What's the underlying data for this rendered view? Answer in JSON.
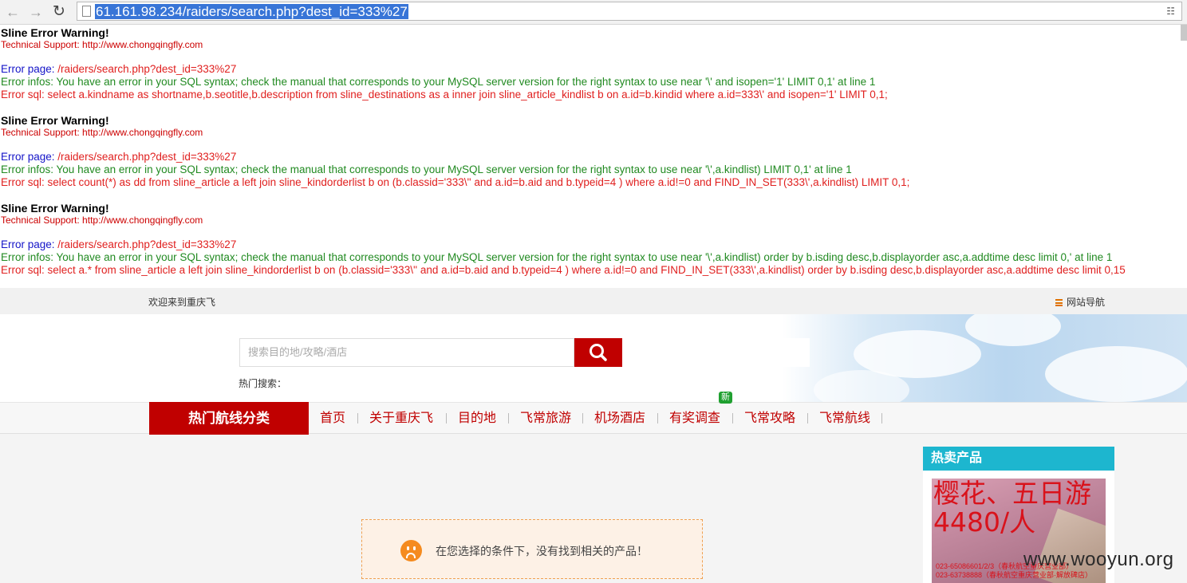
{
  "browser": {
    "url": "61.161.98.234/raiders/search.php?dest_id=333%27",
    "back_icon": "arrow-left-icon",
    "forward_icon": "arrow-right-icon",
    "reload_icon": "reload-icon"
  },
  "errors": [
    {
      "title": "Sline Error Warning!",
      "support": "Technical Support: http://www.chongqingfly.com",
      "page_label": "Error page:",
      "page_value": " /raiders/search.php?dest_id=333%27",
      "infos_label": "Error infos:",
      "infos_value": " You have an error in your SQL syntax; check the manual that corresponds to your MySQL server version for the right syntax to use near '\\' and isopen='1' LIMIT 0,1' at line 1",
      "sql_label": "Error sql:",
      "sql_value": " select a.kindname as shortname,b.seotitle,b.description from sline_destinations as a inner join sline_article_kindlist b on a.id=b.kindid where a.id=333\\' and isopen='1' LIMIT 0,1;"
    },
    {
      "title": "Sline Error Warning!",
      "support": "Technical Support: http://www.chongqingfly.com",
      "page_label": "Error page:",
      "page_value": " /raiders/search.php?dest_id=333%27",
      "infos_label": "Error infos:",
      "infos_value": " You have an error in your SQL syntax; check the manual that corresponds to your MySQL server version for the right syntax to use near '\\',a.kindlist) LIMIT 0,1' at line 1",
      "sql_label": "Error sql:",
      "sql_value": " select count(*) as dd from sline_article a left join sline_kindorderlist b on (b.classid='333\\'' and a.id=b.aid and b.typeid=4 ) where a.id!=0 and FIND_IN_SET(333\\',a.kindlist) LIMIT 0,1;"
    },
    {
      "title": "Sline Error Warning!",
      "support": "Technical Support: http://www.chongqingfly.com",
      "page_label": "Error page:",
      "page_value": " /raiders/search.php?dest_id=333%27",
      "infos_label": "Error infos:",
      "infos_value": " You have an error in your SQL syntax; check the manual that corresponds to your MySQL server version for the right syntax to use near '\\',a.kindlist) order by b.isding desc,b.displayorder asc,a.addtime desc limit 0,' at line 1",
      "sql_label": "Error sql:",
      "sql_value": " select a.* from sline_article a left join sline_kindorderlist b on (b.classid='333\\'' and a.id=b.aid and b.typeid=4 ) where a.id!=0 and FIND_IN_SET(333\\',a.kindlist) order by b.isding desc,b.displayorder asc,a.addtime desc limit 0,15"
    }
  ],
  "topbar": {
    "welcome": "欢迎来到重庆飞",
    "site_nav": "网站导航"
  },
  "search": {
    "placeholder": "搜索目的地/攻略/酒店",
    "hot_label": "热门搜索："
  },
  "menu": {
    "category_button": "热门航线分类",
    "items": [
      "首页",
      "关于重庆飞",
      "目的地",
      "飞常旅游",
      "机场酒店",
      "有奖调查",
      "飞常攻略",
      "飞常航线"
    ],
    "new_badge": "新"
  },
  "content": {
    "empty_message": "在您选择的条件下，没有找到相关的产品！"
  },
  "sidebar": {
    "title": "热卖产品",
    "product_title": "樱花、五日游",
    "product_price": "4480/人",
    "product_phone1": "023-65086601/2/3（春秋航空重庆营业部）",
    "product_phone2": "023-63738888（春秋航空重庆营业部·解放碑店）"
  },
  "watermark": "www.wooyun.org",
  "colors": {
    "brand_red": "#c00000",
    "sidebar_title_bg": "#1db6cf",
    "error_red": "#e0201f",
    "error_green": "#218a21",
    "error_blue": "#1414c8"
  }
}
